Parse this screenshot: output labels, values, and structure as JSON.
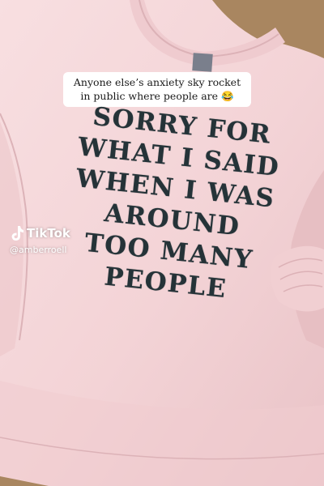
{
  "overlay": {
    "caption": "Anyone else’s anxiety sky rocket in public where people are 😂"
  },
  "shirt_print": {
    "lines": [
      "SORRY FOR",
      "WHAT I SAID",
      "WHEN I WAS",
      "AROUND",
      "TOO MANY",
      "PEOPLE"
    ],
    "ink_color": "#253338"
  },
  "watermark": {
    "icon": "tiktok-note-icon",
    "brand": "TikTok",
    "handle": "@amberroell"
  },
  "colors": {
    "shirt": "#f5d7d9",
    "floor": "#a98660",
    "caption_background": "#ffffff"
  }
}
